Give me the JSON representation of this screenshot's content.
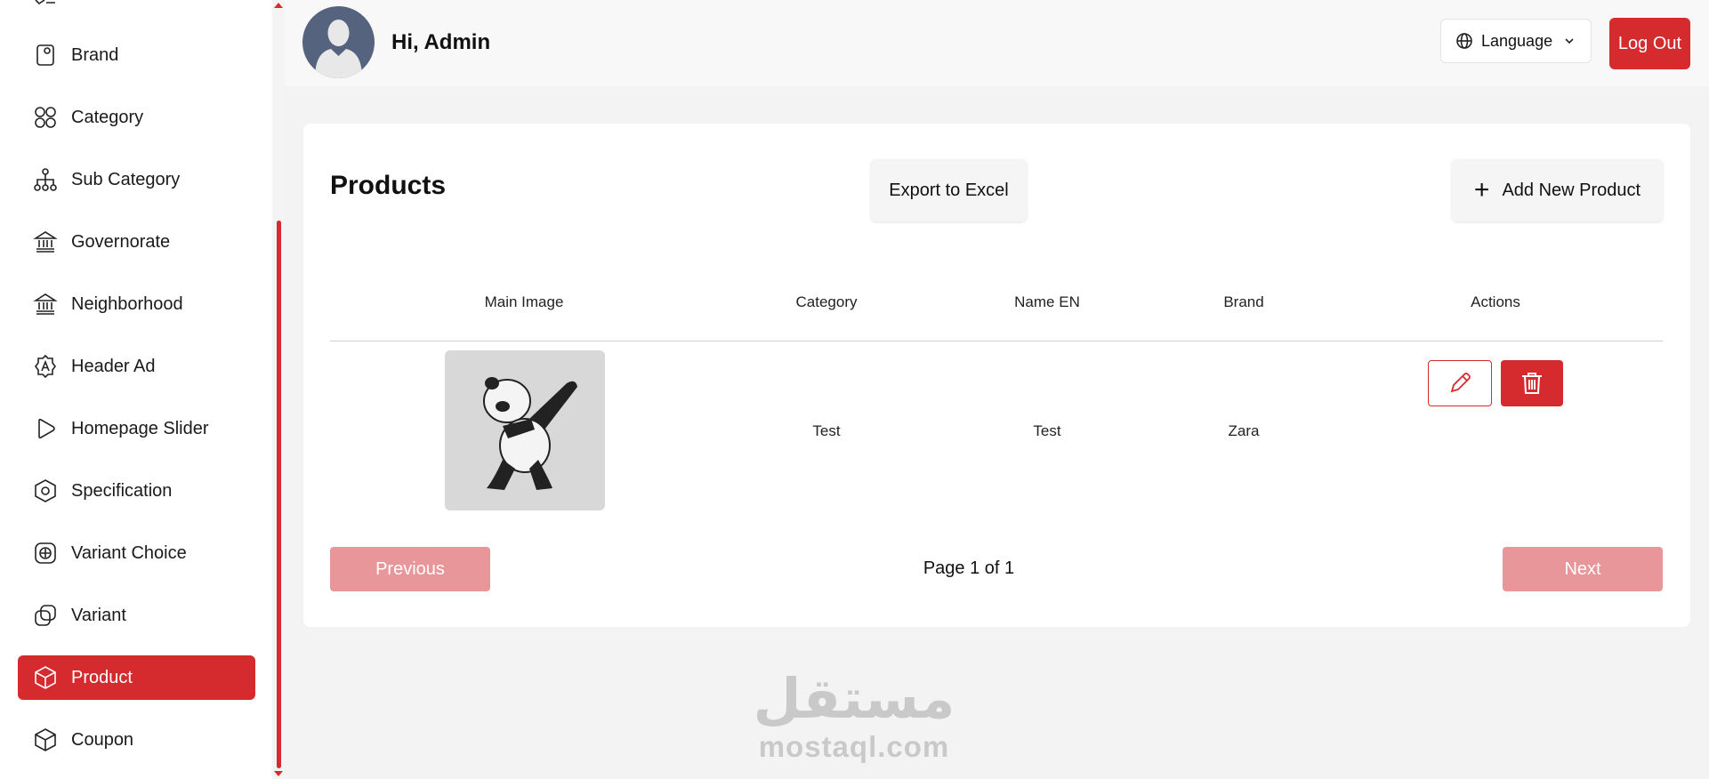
{
  "sidebar": {
    "items": [
      {
        "label": "Brand",
        "icon": "brand-icon",
        "active": false
      },
      {
        "label": "Category",
        "icon": "category-icon",
        "active": false
      },
      {
        "label": "Sub Category",
        "icon": "sub-category-icon",
        "active": false
      },
      {
        "label": "Governorate",
        "icon": "bank-icon",
        "active": false
      },
      {
        "label": "Neighborhood",
        "icon": "bank-icon",
        "active": false
      },
      {
        "label": "Header Ad",
        "icon": "ad-badge-icon",
        "active": false
      },
      {
        "label": "Homepage Slider",
        "icon": "play-icon",
        "active": false
      },
      {
        "label": "Specification",
        "icon": "hexagon-icon",
        "active": false
      },
      {
        "label": "Variant Choice",
        "icon": "plus-square-icon",
        "active": false
      },
      {
        "label": "Variant",
        "icon": "copy-icon",
        "active": false
      },
      {
        "label": "Product",
        "icon": "box-icon",
        "active": true
      },
      {
        "label": "Coupon",
        "icon": "box-icon",
        "active": false
      }
    ]
  },
  "header": {
    "greeting": "Hi, Admin",
    "language_label": "Language",
    "logout_label": "Log Out"
  },
  "main": {
    "title": "Products",
    "export_label": "Export to Excel",
    "add_label": "Add New Product",
    "table": {
      "columns": [
        "Main Image",
        "Category",
        "Name EN",
        "Brand",
        "Actions"
      ],
      "rows": [
        {
          "image": "panda-dab-image",
          "category": "Test",
          "name_en": "Test",
          "brand": "Zara"
        }
      ]
    },
    "pagination": {
      "previous_label": "Previous",
      "page_info": "Page 1 of 1",
      "next_label": "Next"
    }
  },
  "watermark": {
    "arabic": "مستقل",
    "domain": "mostaql.com"
  },
  "colors": {
    "accent": "#d52a2e",
    "accent_disabled": "#e8969a",
    "avatar": "#55637f"
  }
}
